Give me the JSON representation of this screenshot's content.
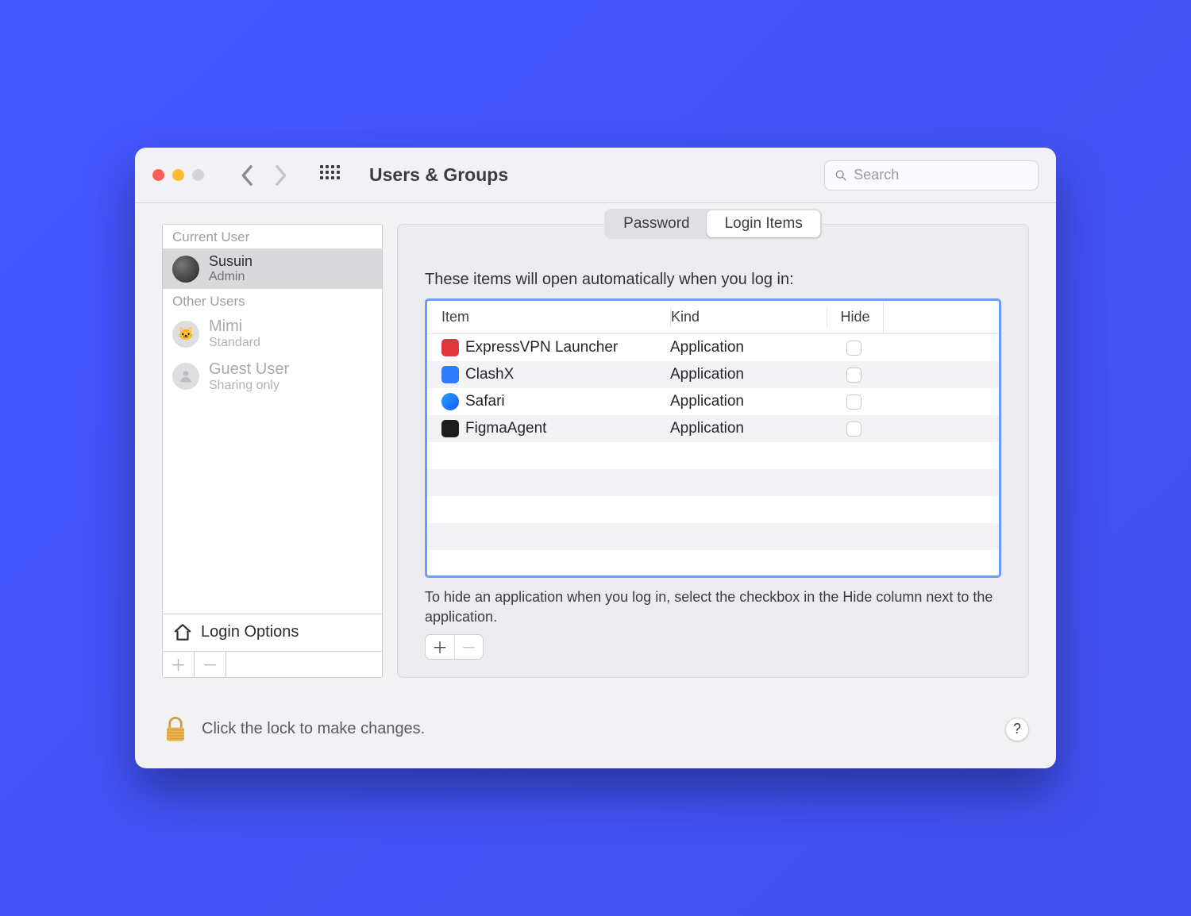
{
  "toolbar": {
    "title": "Users & Groups",
    "search_placeholder": "Search"
  },
  "sidebar": {
    "current_user_label": "Current User",
    "other_users_label": "Other Users",
    "current_user": {
      "name": "Susuin",
      "role": "Admin"
    },
    "other_users": [
      {
        "name": "Mimi",
        "role": "Standard"
      },
      {
        "name": "Guest User",
        "role": "Sharing only"
      }
    ],
    "login_options_label": "Login Options"
  },
  "tabs": {
    "password": "Password",
    "login_items": "Login Items"
  },
  "login_items": {
    "heading": "These items will open automatically when you log in:",
    "columns": {
      "item": "Item",
      "kind": "Kind",
      "hide": "Hide"
    },
    "rows": [
      {
        "name": "ExpressVPN Launcher",
        "kind": "Application",
        "iconClass": "ic-evpn"
      },
      {
        "name": "ClashX",
        "kind": "Application",
        "iconClass": "ic-clash"
      },
      {
        "name": "Safari",
        "kind": "Application",
        "iconClass": "ic-safari"
      },
      {
        "name": "FigmaAgent",
        "kind": "Application",
        "iconClass": "ic-figma"
      }
    ],
    "hint": "To hide an application when you log in, select the checkbox in the Hide column next to the application."
  },
  "footer": {
    "lock_text": "Click the lock to make changes.",
    "help_label": "?"
  }
}
